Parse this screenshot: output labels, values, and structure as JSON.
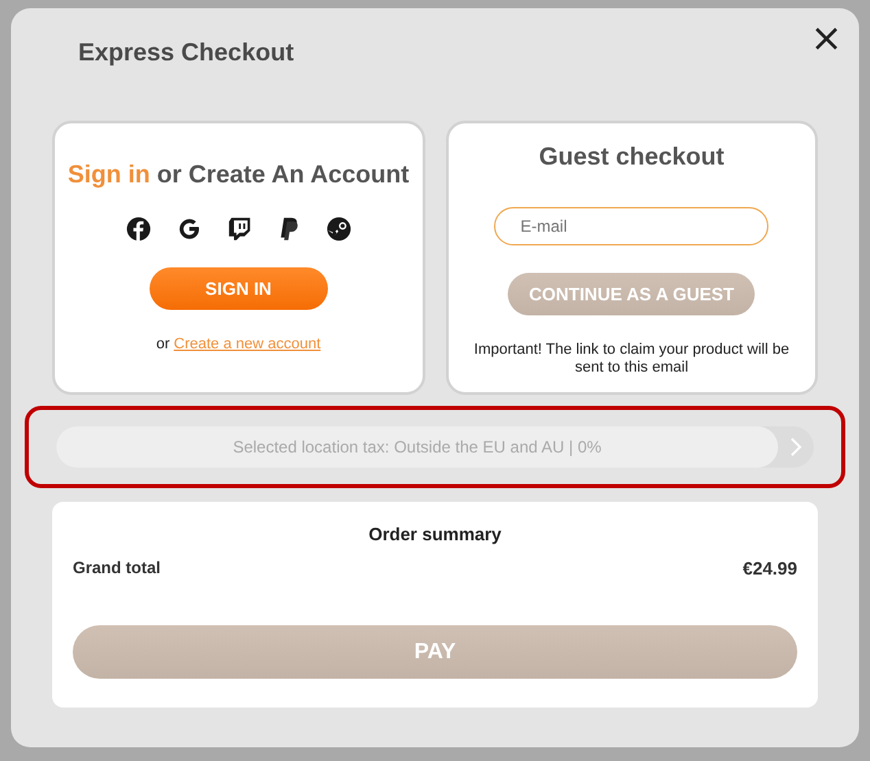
{
  "window": {
    "title": "Express Checkout",
    "close": "×"
  },
  "sign_in": {
    "heading_highlight": "Sign in",
    "heading_rest": "or Create An Account",
    "button": "SIGN IN",
    "link_prefix": "or",
    "link": "Create a new account"
  },
  "guest": {
    "heading": "Guest checkout",
    "email": {
      "placeholder": "E-mail",
      "focused": true
    },
    "button": "CONTINUE AS A GUEST",
    "button_disabled": true,
    "note": "Important! The link to claim your product will be sent to this email"
  },
  "tax": {
    "text": "Selected location tax: Outside the EU and AU | 0%",
    "highlighted": true
  },
  "summary": {
    "title": "Order summary",
    "label": "Grand total",
    "value": "€24.99",
    "button": "PAY",
    "button_disabled": true
  }
}
